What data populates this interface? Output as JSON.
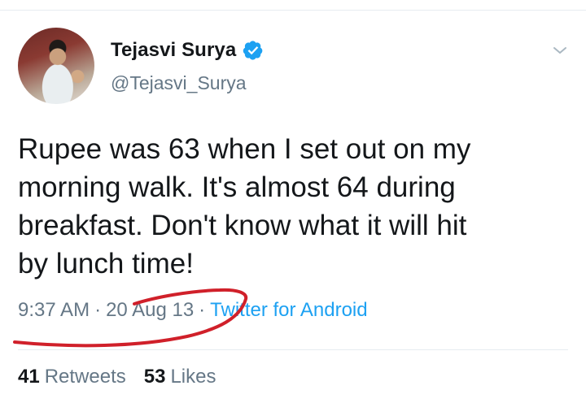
{
  "user": {
    "display_name": "Tejasvi Surya",
    "handle": "@Tejasvi_Surya",
    "verified_icon": "verified-badge-icon",
    "avatar_icon": "profile-photo"
  },
  "tweet": {
    "text": "Rupee was 63 when I set out on my\nmorning walk. It's almost 64 during\nbreakfast. Don't know what it will hit\nby lunch time!",
    "time": "9:37 AM",
    "date": "20 Aug 13",
    "source": "Twitter for Android",
    "separator": "·"
  },
  "stats": {
    "retweets_count": "41",
    "retweets_label": "Retweets",
    "likes_count": "53",
    "likes_label": "Likes"
  },
  "colors": {
    "text": "#14171a",
    "secondary": "#657786",
    "link": "#1da1f2",
    "verified": "#1da1f2",
    "annotation": "#d0202a"
  }
}
